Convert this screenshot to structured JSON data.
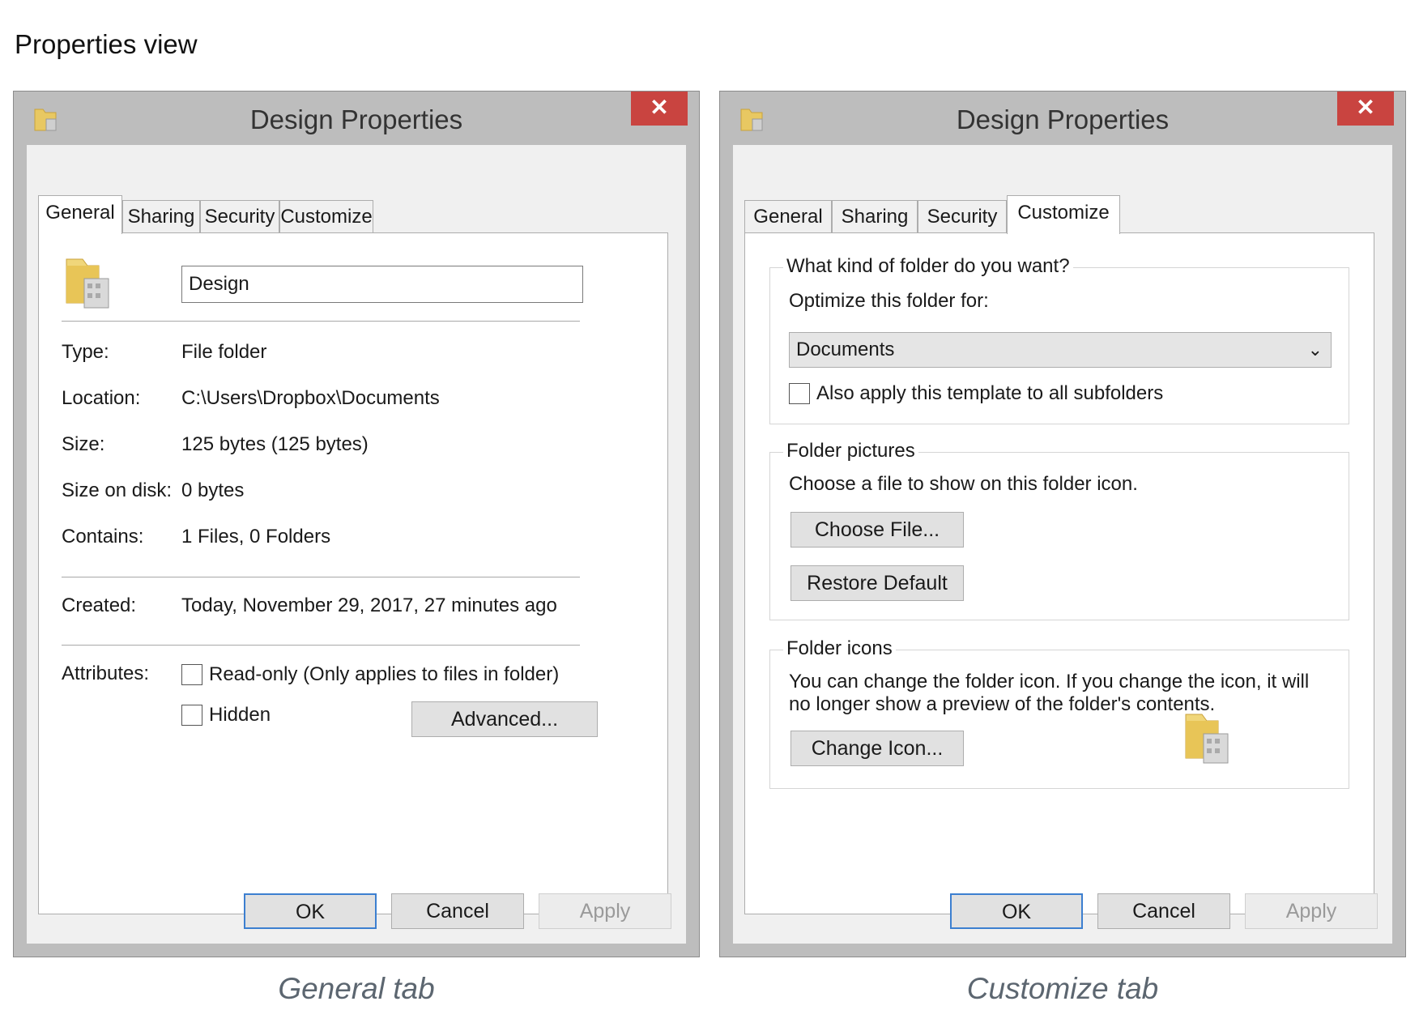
{
  "page_title": "Properties view",
  "windows": [
    {
      "title": "Design Properties",
      "close_label": "✕",
      "tabs": [
        "General",
        "Sharing",
        "Security",
        "Customize"
      ],
      "active_tab": "General",
      "general": {
        "name_value": "Design",
        "rows": [
          {
            "label": "Type:",
            "value": "File folder"
          },
          {
            "label": "Location:",
            "value": "C:\\Users\\Dropbox\\Documents"
          },
          {
            "label": "Size:",
            "value": "125 bytes (125 bytes)"
          },
          {
            "label": "Size on disk:",
            "value": "0 bytes"
          },
          {
            "label": "Contains:",
            "value": "1 Files, 0 Folders"
          }
        ],
        "created_label": "Created:",
        "created_value": "Today, November 29, 2017, 27 minutes ago",
        "attributes_label": "Attributes:",
        "readonly_label": "Read-only (Only applies to files in folder)",
        "hidden_label": "Hidden",
        "advanced_label": "Advanced..."
      },
      "buttons": {
        "ok": "OK",
        "cancel": "Cancel",
        "apply": "Apply"
      },
      "caption": "General tab"
    },
    {
      "title": "Design Properties",
      "close_label": "✕",
      "tabs": [
        "General",
        "Sharing",
        "Security",
        "Customize"
      ],
      "active_tab": "Customize",
      "customize": {
        "group1_title": "What kind of folder do you want?",
        "optimize_label": "Optimize this folder for:",
        "optimize_value": "Documents",
        "apply_template_label": "Also apply this template to all subfolders",
        "group2_title": "Folder pictures",
        "choose_text": "Choose a file to show on this folder icon.",
        "choose_file_label": "Choose File...",
        "restore_default_label": "Restore Default",
        "group3_title": "Folder icons",
        "icons_text_1": "You can change the folder icon. If you change the icon, it will",
        "icons_text_2": "no longer show a preview of the folder's contents.",
        "change_icon_label": "Change Icon..."
      },
      "buttons": {
        "ok": "OK",
        "cancel": "Cancel",
        "apply": "Apply"
      },
      "caption": "Customize tab"
    }
  ],
  "colors": {
    "close": "#c94440",
    "default_button_border": "#3c7fd0",
    "caption": "#5c6670"
  }
}
